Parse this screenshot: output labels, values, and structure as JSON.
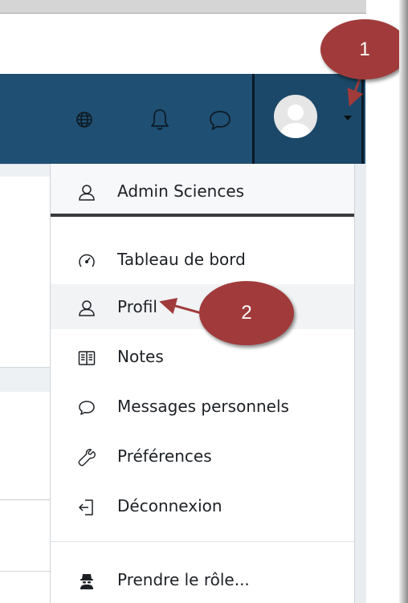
{
  "user_menu": {
    "header": {
      "name": "Admin Sciences"
    },
    "items": [
      {
        "label": "Tableau de bord",
        "icon": "dashboard-gauge-icon"
      },
      {
        "label": "Profil",
        "icon": "user-icon"
      },
      {
        "label": "Notes",
        "icon": "book-icon"
      },
      {
        "label": "Messages personnels",
        "icon": "speech-bubble-icon"
      },
      {
        "label": "Préférences",
        "icon": "wrench-icon"
      },
      {
        "label": "Déconnexion",
        "icon": "sign-out-icon"
      }
    ],
    "footer": {
      "label": "Prendre le rôle...",
      "icon": "user-secret-icon"
    }
  },
  "annotations": {
    "step1": "1",
    "step2": "2",
    "color": "#a13b3b"
  },
  "colors": {
    "navbar": "#1f4f72",
    "menu_text": "#1d2125"
  }
}
